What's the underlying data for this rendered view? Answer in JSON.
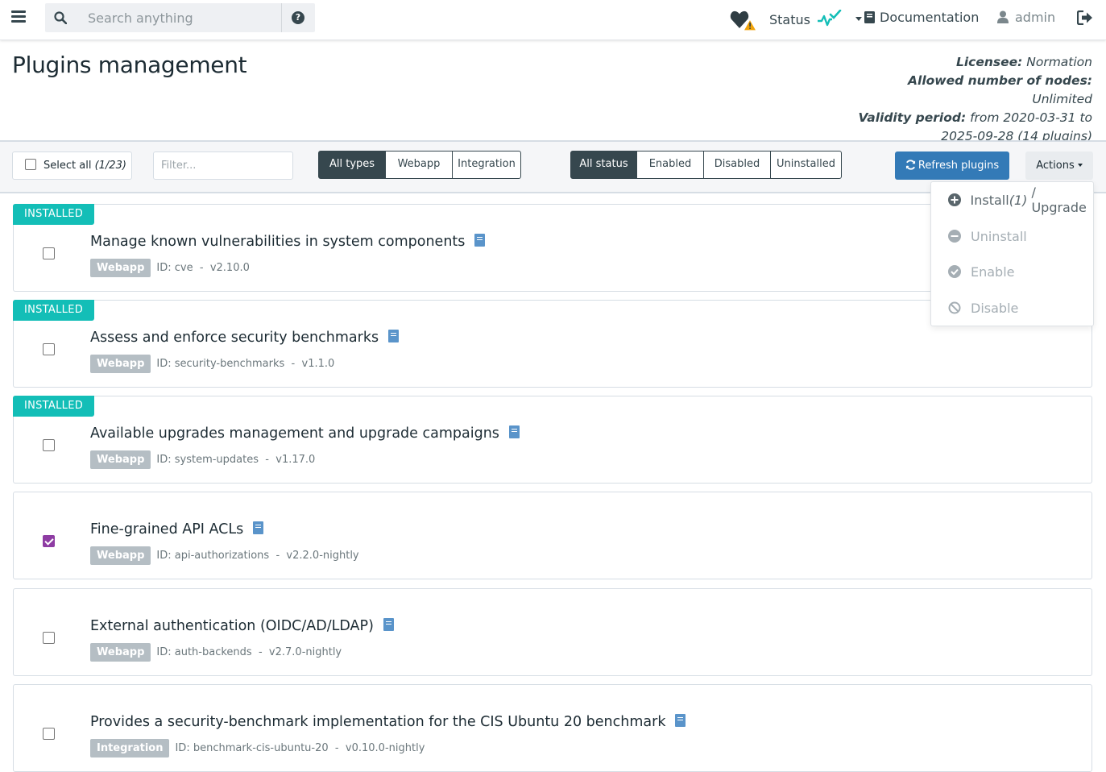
{
  "nav": {
    "search_placeholder": "Search anything",
    "status_label": "Status",
    "documentation_label": "Documentation",
    "user_label": "admin"
  },
  "header": {
    "title": "Plugins management",
    "license": {
      "licensee_label": "Licensee:",
      "licensee_value": "Normation",
      "nodes_label": "Allowed number of nodes:",
      "nodes_value": "Unlimited",
      "validity_label": "Validity period:",
      "validity_value": "from 2020-03-31 to 2025-09-28 (14 plugins)"
    }
  },
  "toolbar": {
    "select_all_label": "Select all",
    "select_all_count": "(1/23)",
    "filter_placeholder": "Filter...",
    "type_filters": [
      "All types",
      "Webapp",
      "Integration"
    ],
    "status_filters": [
      "All status",
      "Enabled",
      "Disabled",
      "Uninstalled"
    ],
    "refresh_label": "Refresh plugins",
    "actions_label": "Actions"
  },
  "actions_menu": {
    "install_label": "Install",
    "install_count": "(1)",
    "upgrade_label": "/ Upgrade",
    "uninstall_label": "Uninstall",
    "enable_label": "Enable",
    "disable_label": "Disable"
  },
  "plugins": [
    {
      "badge": "INSTALLED",
      "name": "Manage known vulnerabilities in system components",
      "type": "Webapp",
      "id": "ID: cve",
      "version": "v2.10.0",
      "checked": false
    },
    {
      "badge": "INSTALLED",
      "name": "Assess and enforce security benchmarks",
      "type": "Webapp",
      "id": "ID: security-benchmarks",
      "version": "v1.1.0",
      "checked": false
    },
    {
      "badge": "INSTALLED",
      "name": "Available upgrades management and upgrade campaigns",
      "type": "Webapp",
      "id": "ID: system-updates",
      "version": "v1.17.0",
      "checked": false
    },
    {
      "badge": "",
      "name": "Fine-grained API ACLs",
      "type": "Webapp",
      "id": "ID: api-authorizations",
      "version": "v2.2.0-nightly",
      "checked": true
    },
    {
      "badge": "",
      "name": "External authentication (OIDC/AD/LDAP)",
      "type": "Webapp",
      "id": "ID: auth-backends",
      "version": "v2.7.0-nightly",
      "checked": false
    },
    {
      "badge": "",
      "name": "Provides a security-benchmark implementation for the CIS Ubuntu 20 benchmark",
      "type": "Integration",
      "id": "ID: benchmark-cis-ubuntu-20",
      "version": "v0.10.0-nightly",
      "checked": false
    }
  ],
  "colors": {
    "installed_ribbon": "#13beb7",
    "primary_button": "#337ab7",
    "checked_checkbox": "#8e3ca3",
    "status_ok": "#13beb7",
    "warning": "#f0a30a"
  }
}
